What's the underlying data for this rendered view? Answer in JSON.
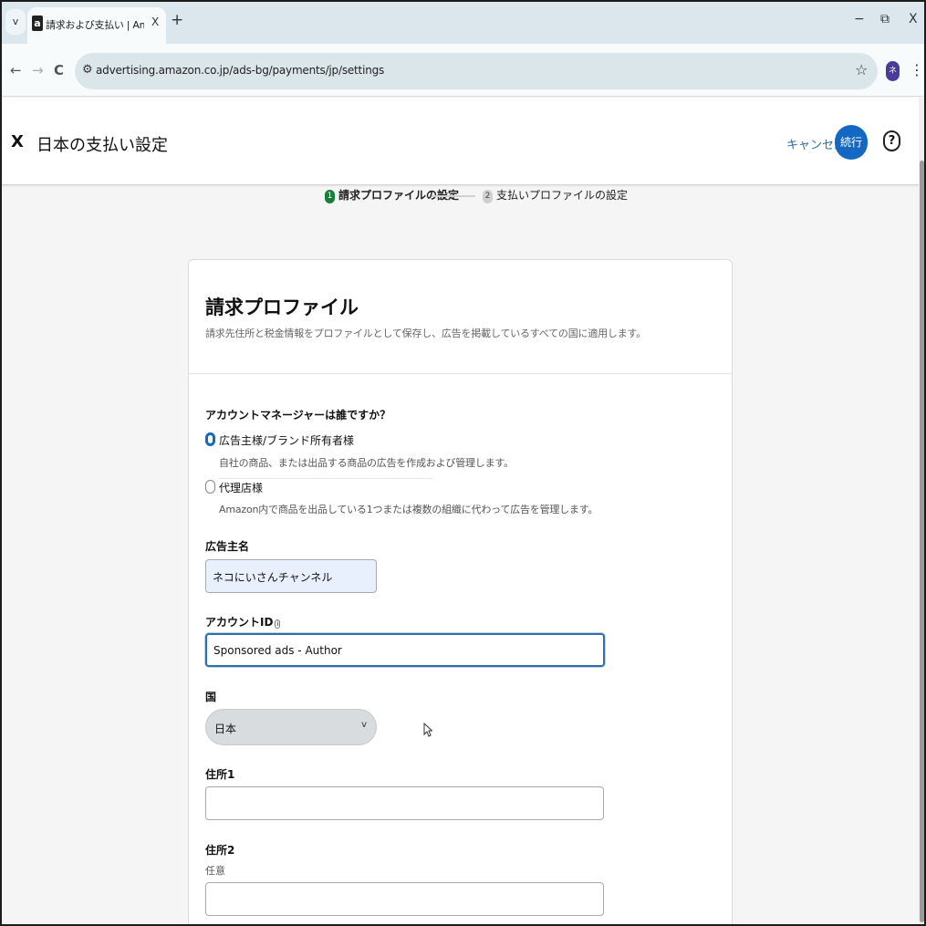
{
  "browser": {
    "tab_menu_label": "v",
    "tab": {
      "favicon": "a",
      "title": "請求および支払い | Amazon Ads",
      "close": "X"
    },
    "new_tab": "+",
    "window_controls": {
      "minimize": "−",
      "restore": "⧉",
      "close": "X"
    },
    "nav": {
      "back": "←",
      "forward": "→",
      "reload": "C"
    },
    "url": "advertising.amazon.co.jp/ads-bg/payments/jp/settings",
    "profile_initial": "ネ"
  },
  "header": {
    "close_label": "X",
    "title": "日本の支払い設定",
    "cancel_label": "キャンセル",
    "continue_label": "続行",
    "help_label": "?"
  },
  "stepper": {
    "steps": [
      {
        "number": "1",
        "label": "請求プロファイルの設定",
        "state": "active"
      },
      {
        "number": "2",
        "label": "支払いプロファイルの設定",
        "state": "inactive"
      }
    ]
  },
  "form": {
    "title": "請求プロファイル",
    "subtitle": "請求先住所と税金情報をプロファイルとして保存し、広告を掲載しているすべての国に適用します。",
    "account_manager": {
      "question": "アカウントマネージャーは誰ですか？",
      "options": [
        {
          "label": "広告主様/ブランド所有者様",
          "description": "自社の商品、または出品する商品の広告を作成および管理します。",
          "checked": true
        },
        {
          "label": "代理店様",
          "description": "Amazon内で商品を出品している1つまたは複数の組織に代わって広告を管理します。",
          "checked": false
        }
      ]
    },
    "advertiser_name": {
      "label": "広告主名",
      "value": "ネコにいさんチャンネル"
    },
    "account_id": {
      "label": "アカウントID",
      "info_icon": "i",
      "value": "Sponsored ads - Author"
    },
    "country": {
      "label": "国",
      "selected": "日本",
      "chevron": "v"
    },
    "address1": {
      "label": "住所1",
      "value": ""
    },
    "address2": {
      "label": "住所2",
      "optional": "任意",
      "value": ""
    }
  },
  "colors": {
    "primary": "#1468c4",
    "step_active": "#1a7d3c",
    "link": "#2a6ea8"
  }
}
